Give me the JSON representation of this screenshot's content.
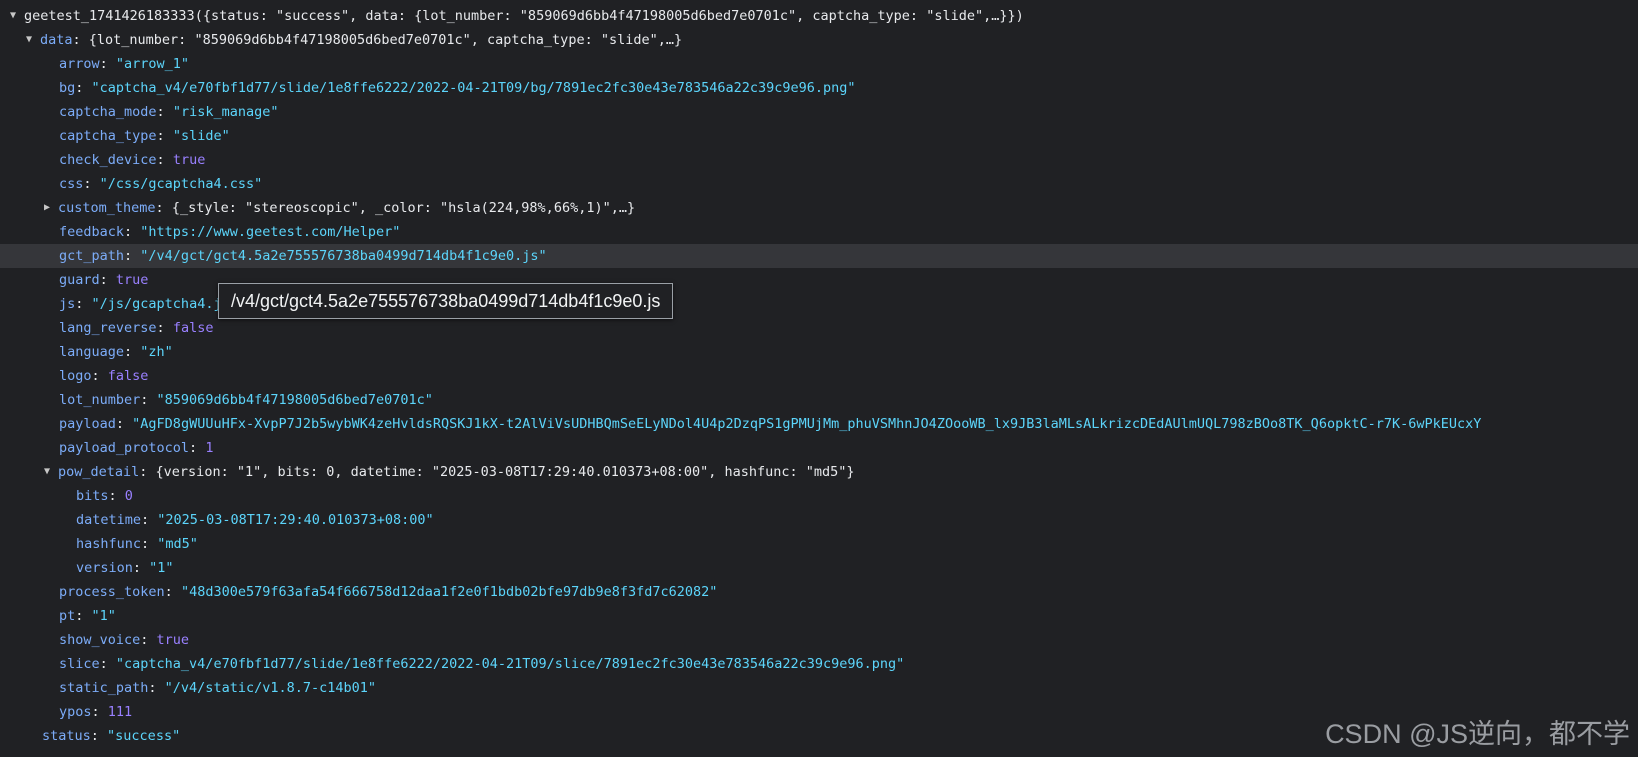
{
  "rows": [
    {
      "k": "geetest_1741426183333",
      "s": "(",
      "v": "{status: \"success\", data: {lot_number: \"859069d6bb4f47198005d6bed7e0701c\", captcha_type: \"slide\",…}}",
      "e": ")"
    },
    {
      "k": "data",
      "s": ": ",
      "v": "{lot_number: \"859069d6bb4f47198005d6bed7e0701c\", captcha_type: \"slide\",…}"
    },
    {
      "k": "arrow",
      "s": ": ",
      "v": "\"arrow_1\""
    },
    {
      "k": "bg",
      "s": ": ",
      "v": "\"captcha_v4/e70fbf1d77/slide/1e8ffe6222/2022-04-21T09/bg/7891ec2fc30e43e783546a22c39c9e96.png\""
    },
    {
      "k": "captcha_mode",
      "s": ": ",
      "v": "\"risk_manage\""
    },
    {
      "k": "captcha_type",
      "s": ": ",
      "v": "\"slide\""
    },
    {
      "k": "check_device",
      "s": ": ",
      "v": "true"
    },
    {
      "k": "css",
      "s": ": ",
      "v": "\"/css/gcaptcha4.css\""
    },
    {
      "k": "custom_theme",
      "s": ": ",
      "v": "{_style: \"stereoscopic\", _color: \"hsla(224,98%,66%,1)\",…}"
    },
    {
      "k": "feedback",
      "s": ": ",
      "v": "\"https://www.geetest.com/Helper\""
    },
    {
      "k": "gct_path",
      "s": ": ",
      "v": "\"/v4/gct/gct4.5a2e755576738ba0499d714db4f1c9e0.js\""
    },
    {
      "k": "guard",
      "s": ": ",
      "v": "true"
    },
    {
      "k": "js",
      "s": ": ",
      "v": "\"/js/gcaptcha4.js\""
    },
    {
      "k": "lang_reverse",
      "s": ": ",
      "v": "false"
    },
    {
      "k": "language",
      "s": ": ",
      "v": "\"zh\""
    },
    {
      "k": "logo",
      "s": ": ",
      "v": "false"
    },
    {
      "k": "lot_number",
      "s": ": ",
      "v": "\"859069d6bb4f47198005d6bed7e0701c\""
    },
    {
      "k": "payload",
      "s": ": ",
      "v": "\"AgFD8gWUUuHFx-XvpP7J2b5wybWK4zeHvldsRQSKJ1kX-t2AlViVsUDHBQmSeELyNDol4U4p2DzqPS1gPMUjMm_phuVSMhnJO4ZOooWB_lx9JB3laMLsALkrizcDEdAUlmUQL798zBOo8TK_Q6opktC-r7K-6wPkEUcxY"
    },
    {
      "k": "payload_protocol",
      "s": ": ",
      "v": "1"
    },
    {
      "k": "pow_detail",
      "s": ": ",
      "v": "{version: \"1\", bits: 0, datetime: \"2025-03-08T17:29:40.010373+08:00\", hashfunc: \"md5\"}"
    },
    {
      "k": "bits",
      "s": ": ",
      "v": "0"
    },
    {
      "k": "datetime",
      "s": ": ",
      "v": "\"2025-03-08T17:29:40.010373+08:00\""
    },
    {
      "k": "hashfunc",
      "s": ": ",
      "v": "\"md5\""
    },
    {
      "k": "version",
      "s": ": ",
      "v": "\"1\""
    },
    {
      "k": "process_token",
      "s": ": ",
      "v": "\"48d300e579f63afa54f666758d12daa1f2e0f1bdb02bfe97db9e8f3fd7c62082\""
    },
    {
      "k": "pt",
      "s": ": ",
      "v": "\"1\""
    },
    {
      "k": "show_voice",
      "s": ": ",
      "v": "true"
    },
    {
      "k": "slice",
      "s": ": ",
      "v": "\"captcha_v4/e70fbf1d77/slide/1e8ffe6222/2022-04-21T09/slice/7891ec2fc30e43e783546a22c39c9e96.png\""
    },
    {
      "k": "static_path",
      "s": ": ",
      "v": "\"/v4/static/v1.8.7-c14b01\""
    },
    {
      "k": "ypos",
      "s": ": ",
      "v": "111"
    },
    {
      "k": "status",
      "s": ": ",
      "v": "\"success\""
    }
  ],
  "tooltip": "/v4/gct/gct4.5a2e755576738ba0499d714db4f1c9e0.js",
  "watermark": "CSDN @JS逆向，都不学",
  "icons": {
    "expanded": "▼",
    "collapsed": "▶"
  }
}
